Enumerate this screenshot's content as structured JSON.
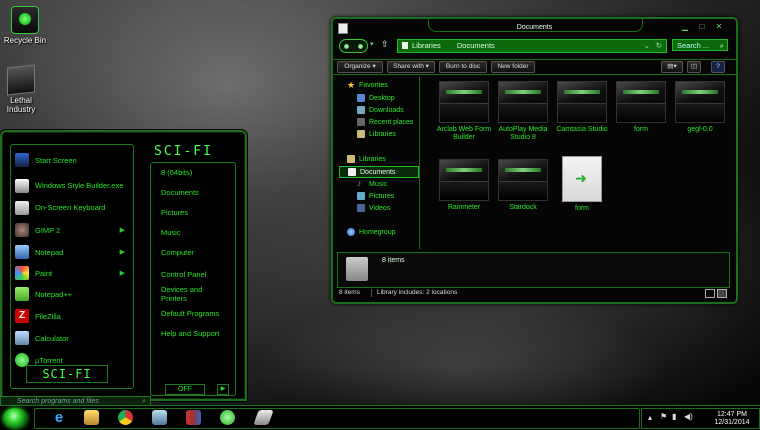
{
  "desktop": {
    "icons": [
      {
        "label": "Recycle Bin",
        "icon": "recycle-bin-icon"
      },
      {
        "label": "Lethal Industry",
        "icon": "lethal-industry-icon"
      }
    ]
  },
  "start_menu": {
    "pinned": [
      {
        "label": "Start Screen",
        "icon": "start-screen-icon",
        "has_arrow": false
      },
      {
        "label": "Windows Style Builder.exe",
        "icon": "style-builder-icon",
        "has_arrow": false
      },
      {
        "label": "On-Screen Keyboard",
        "icon": "keyboard-icon",
        "has_arrow": false
      },
      {
        "label": "GIMP 2",
        "icon": "gimp-icon",
        "has_arrow": true
      },
      {
        "label": "Notepad",
        "icon": "notepad-icon",
        "has_arrow": true
      },
      {
        "label": "Paint",
        "icon": "paint-icon",
        "has_arrow": true
      },
      {
        "label": "Notepad++",
        "icon": "notepadpp-icon",
        "has_arrow": false
      },
      {
        "label": "FileZilla",
        "icon": "filezilla-icon",
        "has_arrow": false
      },
      {
        "label": "Calculator",
        "icon": "calculator-icon",
        "has_arrow": false
      },
      {
        "label": "µTorrent",
        "icon": "utorrent-icon",
        "has_arrow": false
      }
    ],
    "logo_text": "SCI-FI",
    "right_logo_text": "SCI-FI",
    "right_links": [
      "8 (64bits)",
      "Documents",
      "Pictures",
      "Music",
      "Computer",
      "Control Panel",
      "Devices and Printers",
      "Default Programs",
      "Help and Support"
    ],
    "shutdown_label": "OFF",
    "search_placeholder": "Search programs and files",
    "accent": "#27e327"
  },
  "explorer": {
    "title": "Documents",
    "breadcrumb": [
      "Libraries",
      "Documents"
    ],
    "search_placeholder": "Search ...",
    "toolbar": [
      "Organize ▾",
      "Share with ▾",
      "Burn to disc",
      "New folder"
    ],
    "nav": {
      "favorites_header": "Favorites",
      "favorites": [
        "Desktop",
        "Downloads",
        "Recent places",
        "Libraries"
      ],
      "libraries_header": "Libraries",
      "libraries": [
        "Documents",
        "Music",
        "Pictures",
        "Videos"
      ],
      "homegroup": "Homegroup"
    },
    "files": [
      {
        "name": "Arclab Web Form Builder",
        "kind": "folder"
      },
      {
        "name": "AutoPlay Media Studio 8",
        "kind": "folder"
      },
      {
        "name": "Camtasia Studio",
        "kind": "folder"
      },
      {
        "name": "form",
        "kind": "folder"
      },
      {
        "name": "gegl-0.0",
        "kind": "folder"
      },
      {
        "name": "Rainmeter",
        "kind": "folder"
      },
      {
        "name": "Stardock",
        "kind": "folder"
      },
      {
        "name": "form",
        "kind": "document"
      }
    ],
    "details_count": "8 items",
    "status_count": "8 items",
    "status_library": "Library includes: 2 locations"
  },
  "taskbar": {
    "apps": [
      "internet-explorer-icon",
      "file-explorer-icon",
      "chrome-icon",
      "network-icon",
      "winrar-icon",
      "utorrent-icon",
      "tool-icon"
    ],
    "clock_time": "12:47 PM",
    "clock_date": "12/31/2014"
  }
}
